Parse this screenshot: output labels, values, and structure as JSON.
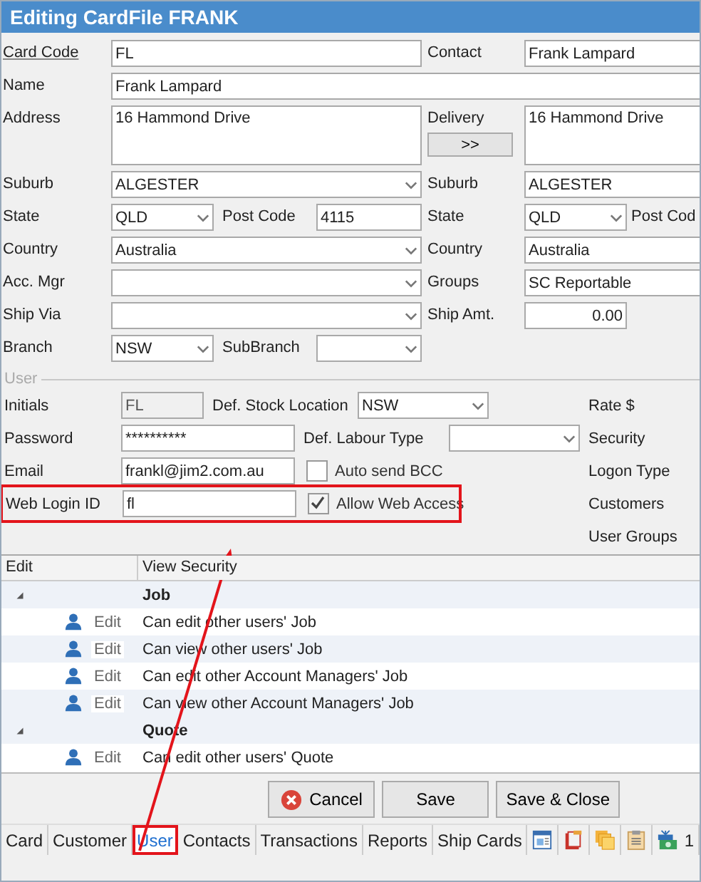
{
  "window": {
    "title": "Editing CardFile FRANK"
  },
  "details": {
    "card_code": {
      "label": "Card Code",
      "value": "FL"
    },
    "contact": {
      "label": "Contact",
      "value": "Frank Lampard"
    },
    "name": {
      "label": "Name",
      "value": "Frank Lampard"
    },
    "address": {
      "label": "Address",
      "value": "16 Hammond Drive"
    },
    "delivery": {
      "label": "Delivery",
      "value": "16 Hammond Drive",
      "copy_button": ">>"
    },
    "suburb": {
      "label": "Suburb",
      "value": "ALGESTER"
    },
    "delivery_suburb": {
      "label": "Suburb",
      "value": "ALGESTER"
    },
    "state": {
      "label": "State",
      "value": "QLD"
    },
    "post_code": {
      "label": "Post Code",
      "value": "4115"
    },
    "delivery_state": {
      "label": "State",
      "value": "QLD"
    },
    "delivery_post_code": {
      "label": "Post Cod"
    },
    "country": {
      "label": "Country",
      "value": "Australia"
    },
    "delivery_country": {
      "label": "Country",
      "value": "Australia"
    },
    "acc_mgr": {
      "label": "Acc. Mgr"
    },
    "groups": {
      "label": "Groups",
      "value": "SC Reportable"
    },
    "ship_via": {
      "label": "Ship Via"
    },
    "ship_amt": {
      "label": "Ship Amt.",
      "value": "0.00"
    },
    "branch": {
      "label": "Branch",
      "value": "NSW"
    },
    "subbranch": {
      "label": "SubBranch"
    }
  },
  "user": {
    "title": "User",
    "initials": {
      "label": "Initials",
      "value": "FL"
    },
    "password": {
      "label": "Password",
      "value": "**********"
    },
    "email": {
      "label": "Email",
      "value": "frankl@jim2.com.au"
    },
    "web_login_id": {
      "label": "Web Login ID",
      "value": "fl"
    },
    "def_stock_location": {
      "label": "Def. Stock Location",
      "value": "NSW"
    },
    "def_labour_type": {
      "label": "Def. Labour Type"
    },
    "auto_send_bcc": {
      "label": "Auto send BCC",
      "checked": false
    },
    "allow_web_access": {
      "label": "Allow Web Access",
      "checked": true
    },
    "side_labels": [
      "Rate $",
      "Security",
      "Logon Type",
      "Customers",
      "User Groups"
    ]
  },
  "security_grid": {
    "columns": [
      "Edit",
      "View Security"
    ],
    "groups": [
      {
        "name": "Job",
        "expanded": true,
        "children": [
          {
            "action": "Edit",
            "text": "Can edit other users' Job"
          },
          {
            "action": "Edit",
            "text": "Can view other users' Job"
          },
          {
            "action": "Edit",
            "text": "Can edit other Account Managers' Job"
          },
          {
            "action": "Edit",
            "text": "Can view other Account Managers' Job"
          }
        ]
      },
      {
        "name": "Quote",
        "expanded": true,
        "children": [
          {
            "action": "Edit",
            "text": "Can edit other users' Quote"
          }
        ]
      }
    ]
  },
  "buttons": [
    {
      "label": "Cancel",
      "kind": "cancel"
    },
    {
      "label": "Save",
      "kind": "plain"
    },
    {
      "label": "Save & Close",
      "kind": "plain"
    }
  ],
  "tabs": [
    {
      "kind": "text",
      "label": "Card",
      "selected": false
    },
    {
      "kind": "text",
      "label": "Customer",
      "selected": false
    },
    {
      "kind": "text",
      "label": "User",
      "selected": true
    },
    {
      "kind": "text",
      "label": "Contacts",
      "selected": false
    },
    {
      "kind": "text",
      "label": "Transactions",
      "selected": false
    },
    {
      "kind": "text",
      "label": "Reports",
      "selected": false
    },
    {
      "kind": "text",
      "label": "Ship Cards",
      "selected": false
    },
    {
      "kind": "document",
      "selected": false
    },
    {
      "kind": "clipboard",
      "selected": false
    },
    {
      "kind": "folders",
      "selected": false
    },
    {
      "kind": "notepad",
      "selected": false
    },
    {
      "kind": "gift",
      "count": "1",
      "selected": false
    }
  ]
}
